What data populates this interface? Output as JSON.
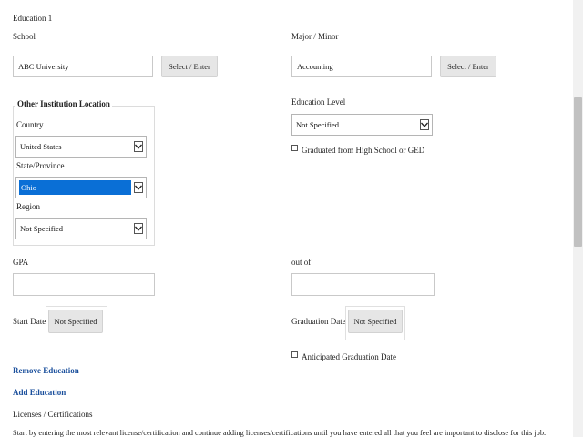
{
  "section_title": "Education 1",
  "school": {
    "label": "School",
    "value": "ABC University",
    "button": "Select / Enter"
  },
  "major": {
    "label": "Major / Minor",
    "value": "Accounting",
    "button": "Select / Enter"
  },
  "location": {
    "legend": "Other Institution Location",
    "country_label": "Country",
    "country_value": "United States",
    "state_label": "State/Province",
    "state_value": "Ohio",
    "region_label": "Region",
    "region_value": "Not Specified"
  },
  "education_level": {
    "label": "Education Level",
    "value": "Not Specified",
    "graduated_hs_label": "Graduated from High School or GED",
    "graduated_hs_checked": false
  },
  "gpa": {
    "label": "GPA",
    "value": "",
    "out_of_label": "out of",
    "out_of_value": ""
  },
  "dates": {
    "start_label": "Start Date",
    "start_value": "Not Specified",
    "graduation_label": "Graduation Date",
    "graduation_value": "Not Specified",
    "anticipated_label": "Anticipated Graduation Date",
    "anticipated_checked": false
  },
  "actions": {
    "remove": "Remove Education",
    "add": "Add Education"
  },
  "licenses": {
    "title": "Licenses / Certifications",
    "instructions": "Start by entering the most relevant license/certification and continue adding licenses/certifications until you have entered all that you feel are important to disclose for this job."
  },
  "colors": {
    "link": "#1a4f9c",
    "selection": "#0a6fd6"
  }
}
